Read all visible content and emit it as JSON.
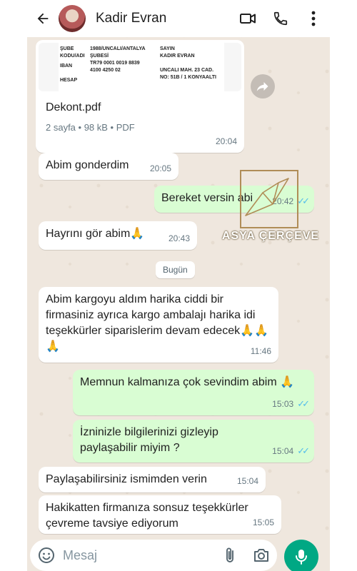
{
  "header": {
    "contact_name": "Kadir Evran"
  },
  "document": {
    "preview": {
      "sube_label": "ŞUBE",
      "kodu_label": "KODU/ADI",
      "sube_value": "1988/UNCALI/ANTALYA",
      "subesi_value": "ŞUBESİ",
      "iban_label": "IBAN",
      "iban_value_1": "TR79 0001 0019 8839",
      "iban_value_2": "4100 4250 02",
      "hesap_label": "HESAP",
      "sayin_label": "SAYIN",
      "recipient": "KADIR EVRAN",
      "address_1": "UNCALI MAH. 23 CAD.",
      "address_2": "NO: 51B / 1 KONYAALTI"
    },
    "file_name": "Dekont.pdf",
    "meta": "2 sayfa • 98 kB • PDF",
    "time": "20:04"
  },
  "messages": [
    {
      "text": "Abim gonderdim",
      "time": "20:05"
    },
    {
      "text": "Bereket versin abi",
      "time": "20:42"
    },
    {
      "text": "Hayrını gör abim🙏",
      "time": "20:43"
    },
    {
      "text": "Abim kargoyu aldım harika ciddi bir firmasiniz ayrıca kargo ambalajı harika idi teşekkürler siparislerim devam edecek🙏🙏🙏",
      "time": "11:46"
    },
    {
      "text": "Memnun kalmanıza çok sevindim abim 🙏",
      "time": "15:03"
    },
    {
      "text": "İzninizle bilgilerinizi gizleyip paylaşabilir miyim ?",
      "time": "15:04"
    },
    {
      "text": "Paylaşabilirsiniz ismimden verin",
      "time": "15:04"
    },
    {
      "text": "Hakikatten firmanıza sonsuz teşekkürler çevreme tavsiye ediyorum",
      "time": "15:05"
    }
  ],
  "date_divider": "Bugün",
  "watermark": {
    "text": "ASYA ÇERÇEVE"
  },
  "composer": {
    "placeholder": "Mesaj"
  },
  "colors": {
    "outgoing_bubble": "#d9fdd3",
    "incoming_bubble": "#ffffff",
    "read_ticks": "#53bdeb",
    "mic_button": "#00a884",
    "chat_background": "#efe7de"
  },
  "icons": [
    "back-arrow-icon",
    "video-call-icon",
    "phone-icon",
    "more-vert-icon",
    "forward-icon",
    "emoji-icon",
    "attach-icon",
    "camera-icon",
    "mic-icon"
  ]
}
